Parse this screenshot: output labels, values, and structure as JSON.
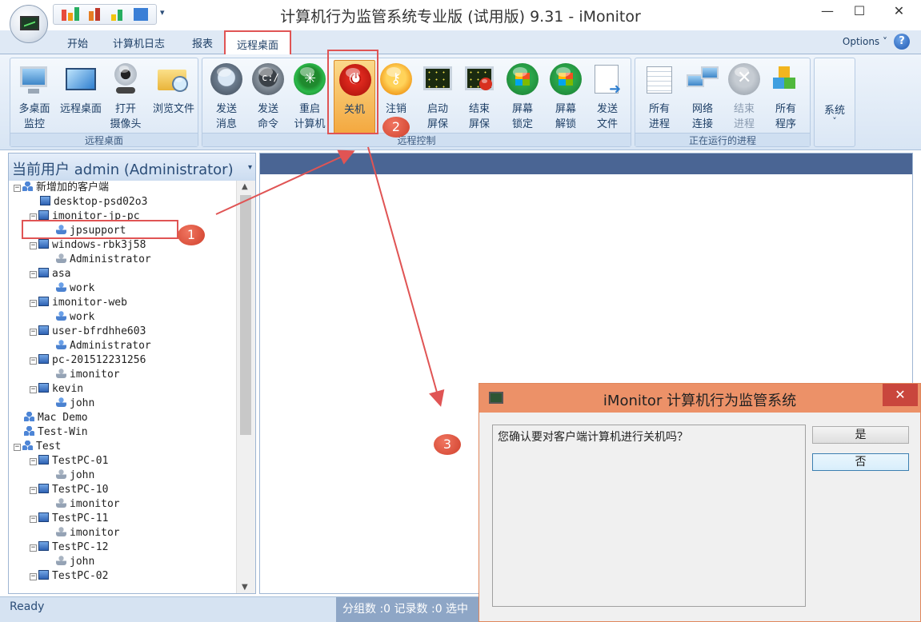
{
  "window": {
    "title": "计算机行为监管系统专业版 (试用版) 9.31 - iMonitor",
    "minimize_glyph": "—",
    "maximize_glyph": "☐",
    "close_glyph": "✕",
    "qat_dropdown_glyph": "▾"
  },
  "tabs": [
    {
      "label": "开始"
    },
    {
      "label": "计算机日志"
    },
    {
      "label": "报表"
    },
    {
      "label": "远程桌面"
    }
  ],
  "options_label": "Options ˅",
  "help_glyph": "?",
  "ribbon": {
    "groups": [
      {
        "label": "远程桌面",
        "buttons": [
          {
            "line1": "多桌面",
            "line2": "监控",
            "icon": "multi-desktop-icon"
          },
          {
            "line1": "远程桌面",
            "line2": "",
            "icon": "remote-desktop-icon"
          },
          {
            "line1": "打开",
            "line2": "摄像头",
            "icon": "webcam-icon"
          },
          {
            "line1": "浏览文件",
            "line2": "",
            "icon": "folder-search-icon"
          }
        ]
      },
      {
        "label": "远程控制",
        "buttons": [
          {
            "line1": "发送",
            "line2": "消息",
            "icon": "message-icon"
          },
          {
            "line1": "发送",
            "line2": "命令",
            "icon": "command-icon"
          },
          {
            "line1": "重启",
            "line2": "计算机",
            "icon": "restart-icon"
          },
          {
            "line1": "关机",
            "line2": "",
            "icon": "power-icon",
            "pressed": true
          },
          {
            "line1": "注销",
            "line2": "用户",
            "icon": "key-icon"
          },
          {
            "line1": "启动",
            "line2": "屏保",
            "icon": "screensaver-start-icon"
          },
          {
            "line1": "结束",
            "line2": "屏保",
            "icon": "screensaver-stop-icon"
          },
          {
            "line1": "屏幕",
            "line2": "锁定",
            "icon": "screen-lock-icon"
          },
          {
            "line1": "屏幕",
            "line2": "解锁",
            "icon": "screen-unlock-icon"
          },
          {
            "line1": "发送",
            "line2": "文件",
            "icon": "send-file-icon"
          }
        ]
      },
      {
        "label": "正在运行的进程",
        "buttons": [
          {
            "line1": "所有",
            "line2": "进程",
            "icon": "processes-icon"
          },
          {
            "line1": "网络",
            "line2": "连接",
            "icon": "network-icon"
          },
          {
            "line1": "结束",
            "line2": "进程",
            "icon": "kill-process-icon",
            "disabled": true
          },
          {
            "line1": "所有",
            "line2": "程序",
            "icon": "programs-icon"
          }
        ]
      }
    ],
    "system_label": "系统",
    "system_arrow": "˅"
  },
  "left_panel": {
    "header": "当前用户 admin (Administrator)",
    "header_arrow": "▾",
    "tree": [
      {
        "label": "新增加的客户端",
        "level": 0,
        "type": "group",
        "expand": "⊟"
      },
      {
        "label": "desktop-psd02o3",
        "level": 1,
        "type": "pc",
        "expand": ""
      },
      {
        "label": "imonitor-jp-pc",
        "level": 1,
        "type": "pc",
        "expand": "⊟"
      },
      {
        "label": "jpsupport",
        "level": 2,
        "type": "user",
        "expand": "",
        "highlight": true
      },
      {
        "label": "windows-rbk3j58",
        "level": 1,
        "type": "pc",
        "expand": "⊟"
      },
      {
        "label": "Administrator",
        "level": 2,
        "type": "user-gray",
        "expand": ""
      },
      {
        "label": "asa",
        "level": 1,
        "type": "pc",
        "expand": "⊟"
      },
      {
        "label": "work",
        "level": 2,
        "type": "user",
        "expand": ""
      },
      {
        "label": "imonitor-web",
        "level": 1,
        "type": "pc",
        "expand": "⊟"
      },
      {
        "label": "work",
        "level": 2,
        "type": "user",
        "expand": ""
      },
      {
        "label": "user-bfrdhhe603",
        "level": 1,
        "type": "pc",
        "expand": "⊟"
      },
      {
        "label": "Administrator",
        "level": 2,
        "type": "user",
        "expand": ""
      },
      {
        "label": "pc-201512231256",
        "level": 1,
        "type": "pc",
        "expand": "⊟"
      },
      {
        "label": "imonitor",
        "level": 2,
        "type": "user-gray",
        "expand": ""
      },
      {
        "label": "kevin",
        "level": 1,
        "type": "pc",
        "expand": "⊟"
      },
      {
        "label": "john",
        "level": 2,
        "type": "user",
        "expand": ""
      },
      {
        "label": "Mac Demo",
        "level": 0,
        "type": "group",
        "expand": ""
      },
      {
        "label": "Test-Win",
        "level": 0,
        "type": "group",
        "expand": ""
      },
      {
        "label": "Test",
        "level": 0,
        "type": "group",
        "expand": "⊟"
      },
      {
        "label": "TestPC-01",
        "level": 1,
        "type": "pc",
        "expand": "⊟"
      },
      {
        "label": "john",
        "level": 2,
        "type": "user-gray",
        "expand": ""
      },
      {
        "label": "TestPC-10",
        "level": 1,
        "type": "pc",
        "expand": "⊟"
      },
      {
        "label": "imonitor",
        "level": 2,
        "type": "user-gray",
        "expand": ""
      },
      {
        "label": "TestPC-11",
        "level": 1,
        "type": "pc",
        "expand": "⊟"
      },
      {
        "label": "imonitor",
        "level": 2,
        "type": "user-gray",
        "expand": ""
      },
      {
        "label": "TestPC-12",
        "level": 1,
        "type": "pc",
        "expand": "⊟"
      },
      {
        "label": "john",
        "level": 2,
        "type": "user-gray",
        "expand": ""
      },
      {
        "label": "TestPC-02",
        "level": 1,
        "type": "pc",
        "expand": "⊟"
      }
    ],
    "scroll_up": "▲",
    "scroll_down": "▼"
  },
  "status": {
    "ready": "Ready",
    "counts": "分组数 :0  记录数 :0  选中"
  },
  "dialog": {
    "title": "iMonitor 计算机行为监管系统",
    "close_glyph": "✕",
    "message": "您确认要对客户端计算机进行关机吗？",
    "yes": "是",
    "no": "否"
  },
  "annotations": [
    "1",
    "2",
    "3"
  ],
  "colors": {
    "highlight_red": "#e05454",
    "dialog_title": "#ec9168",
    "right_header": "#4a6594"
  }
}
